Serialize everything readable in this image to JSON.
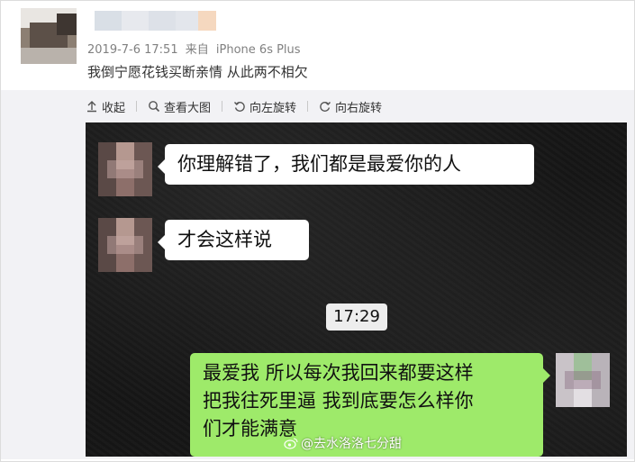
{
  "post": {
    "date": "2019-7-6 17:51",
    "from": "来自",
    "device": "iPhone 6s Plus",
    "text": "我倒宁愿花钱买断亲情 从此两不相欠"
  },
  "toolbar": {
    "collapse": "收起",
    "view_large": "查看大图",
    "rotate_left": "向左旋转",
    "rotate_right": "向右旋转"
  },
  "chat": {
    "msg1": "你理解错了，我们都是最爱你的人",
    "msg2": "才会这样说",
    "time": "17:29",
    "msg3_line1": "最爱我 所以每次我回来都要这样",
    "msg3_line2": "把我往死里逼 我到底要怎么样你",
    "msg3_line3": "们才能满意",
    "watermark": "@去水洛洛七分甜"
  },
  "colors": {
    "incoming_bubble": "#ffffff",
    "outgoing_bubble": "#9eea6a",
    "chat_background": "#161616"
  }
}
